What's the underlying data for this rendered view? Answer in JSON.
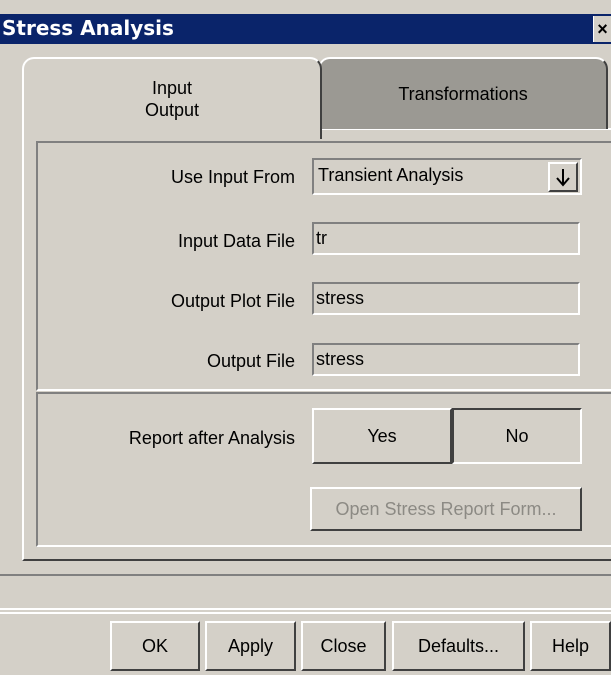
{
  "window": {
    "title": "Stress Analysis",
    "close_glyph": "×"
  },
  "tabs": {
    "active": {
      "line1": "Input",
      "line2": "Output"
    },
    "inactive": {
      "label": "Transformations"
    }
  },
  "form": {
    "use_input_label": "Use Input From",
    "use_input_value": "Transient Analysis",
    "use_input_icon": "arrow-down-icon",
    "input_data_label": "Input Data File",
    "input_data_value": "tr",
    "output_plot_label": "Output Plot File",
    "output_plot_value": "stress",
    "output_file_label": "Output File",
    "output_file_value": "stress"
  },
  "report": {
    "label": "Report after Analysis",
    "yes_label": "Yes",
    "no_label": "No",
    "selected": "No",
    "open_form_label": "Open Stress Report Form..."
  },
  "buttons": {
    "ok": "OK",
    "apply": "Apply",
    "close": "Close",
    "defaults": "Defaults...",
    "help": "Help"
  },
  "colors": {
    "title_bar": "#0a246a",
    "face": "#d4d0c8",
    "inactive_tab": "#9b9993",
    "disabled_text": "#8c8a84"
  }
}
